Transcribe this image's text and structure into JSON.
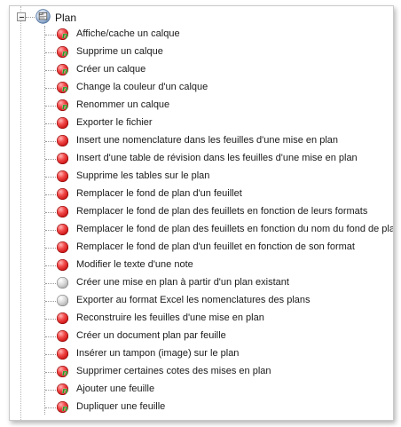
{
  "tree": {
    "root": {
      "label": "Plan",
      "icon": "plan-document-icon",
      "expanded": true
    },
    "items": [
      {
        "label": "Affiche/cache un calque",
        "status": "red",
        "new": true
      },
      {
        "label": "Supprime un calque",
        "status": "red",
        "new": true
      },
      {
        "label": "Créer un calque",
        "status": "red",
        "new": true
      },
      {
        "label": "Change la couleur d'un calque",
        "status": "red",
        "new": true
      },
      {
        "label": "Renommer un calque",
        "status": "red",
        "new": true
      },
      {
        "label": "Exporter le fichier",
        "status": "red",
        "new": false
      },
      {
        "label": "Insert une nomenclature dans les feuilles d'une mise en plan",
        "status": "red",
        "new": false
      },
      {
        "label": "Insert d'une table de révision dans les feuilles d'une mise en plan",
        "status": "red",
        "new": false
      },
      {
        "label": "Supprime les tables sur le plan",
        "status": "red",
        "new": false
      },
      {
        "label": "Remplacer le fond de plan d'un feuillet",
        "status": "red",
        "new": false
      },
      {
        "label": "Remplacer le fond de plan des feuillets en fonction de leurs formats",
        "status": "red",
        "new": false
      },
      {
        "label": "Remplacer le fond de plan des feuillets en fonction du nom du fond de plan",
        "status": "red",
        "new": false
      },
      {
        "label": "Remplacer le fond de plan d'un feuillet en fonction de son format",
        "status": "red",
        "new": false
      },
      {
        "label": "Modifier le texte d'une note",
        "status": "red",
        "new": false
      },
      {
        "label": "Créer une mise en plan à partir d'un plan existant",
        "status": "gray",
        "new": false
      },
      {
        "label": "Exporter au format Excel les nomenclatures des plans",
        "status": "gray",
        "new": false
      },
      {
        "label": "Reconstruire les feuilles d'une mise en plan",
        "status": "red",
        "new": false
      },
      {
        "label": "Créer un document plan par feuille",
        "status": "red",
        "new": false
      },
      {
        "label": "Insérer un tampon (image) sur le plan",
        "status": "red",
        "new": false
      },
      {
        "label": "Supprimer certaines cotes des mises en plan",
        "status": "red",
        "new": true
      },
      {
        "label": "Ajouter une feuille",
        "status": "red",
        "new": true
      },
      {
        "label": "Dupliquer une feuille",
        "status": "red",
        "new": true
      }
    ],
    "new_badge": "n"
  },
  "colors": {
    "status_red": "#d01818",
    "status_gray": "#a8a8a8",
    "new_badge": "#1f9c1f"
  }
}
